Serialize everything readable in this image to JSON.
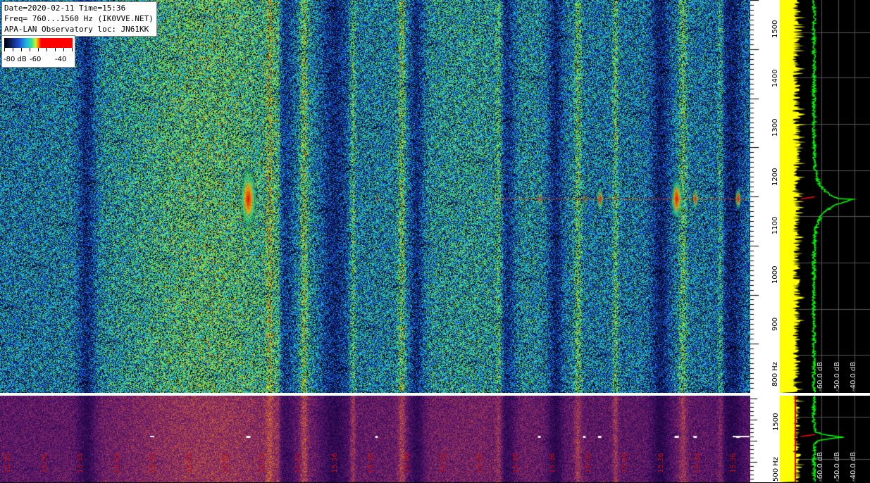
{
  "info": {
    "line1": "Date=2020-02-11 Time=15:36",
    "line2": "Freq= 760...1560 Hz (IK0VVE.NET)",
    "line3": "APA-LAN Observatory loc: JN61KK"
  },
  "legend": {
    "labels": [
      "-80 dB",
      "-60",
      "-40"
    ]
  },
  "colors": {
    "background": "#000000",
    "spectrum_fill": "#ffff00",
    "spectrum_line": "#00ff00",
    "peak_marker": "#ff0000",
    "time_label": "#c01010"
  },
  "chart_data": [
    {
      "type": "heatmap",
      "name_hint": "main-waterfall",
      "ylabel": "Hz",
      "y_ticks": [
        800,
        900,
        1000,
        1100,
        1200,
        1300,
        1400,
        1500
      ],
      "y_tick_labels": [
        "800 Hz",
        "900",
        "1000",
        "1100",
        "1200",
        "1300",
        "1400",
        "1500"
      ],
      "ylim": [
        760,
        1560
      ],
      "colorbar": {
        "min": -80,
        "max": -40,
        "unit": "dB"
      },
      "strong_signal_hz": 1155,
      "signal_bursts": [
        {
          "col_frac": 0.331,
          "strength": 1.0,
          "span": 3.0
        },
        {
          "col_frac": 0.503,
          "strength": 0.35,
          "span": 0.5
        },
        {
          "col_frac": 0.72,
          "strength": 0.55,
          "span": 0.6
        },
        {
          "col_frac": 0.78,
          "strength": 0.4,
          "span": 0.6
        },
        {
          "col_frac": 0.8,
          "strength": 0.75,
          "span": 1.0
        },
        {
          "col_frac": 0.902,
          "strength": 1.0,
          "span": 2.0
        },
        {
          "col_frac": 0.927,
          "strength": 0.8,
          "span": 0.8
        },
        {
          "col_frac": 0.984,
          "strength": 0.9,
          "span": 0.8
        }
      ]
    },
    {
      "type": "line",
      "name_hint": "main-spectrum",
      "x_ticks": [
        -60,
        -50,
        -40
      ],
      "x_tick_labels": [
        "-60.0 dB",
        "-50.0 dB",
        "-40.0 dB"
      ],
      "peak_hz": 1155,
      "peak_db": -42
    },
    {
      "type": "heatmap",
      "name_hint": "overview-waterfall",
      "y_ticks": [
        500,
        1500
      ],
      "y_tick_labels": [
        "500 Hz",
        "1500"
      ],
      "time_labels": [
        "15:35",
        "15:35",
        "15:35",
        "15:35",
        "15:35",
        "15:35",
        "15:35",
        "15:35",
        "15:35",
        "15:36",
        "15:36",
        "15:36",
        "15:36",
        "15:36",
        "15:36",
        "15:36",
        "15:36",
        "15:36",
        "15:36",
        "15:36",
        "15:36"
      ]
    },
    {
      "type": "line",
      "name_hint": "overview-spectrum",
      "x_tick_labels": [
        "-60.0 dB",
        "-50.0 dB",
        "-40.0 dB"
      ]
    }
  ]
}
